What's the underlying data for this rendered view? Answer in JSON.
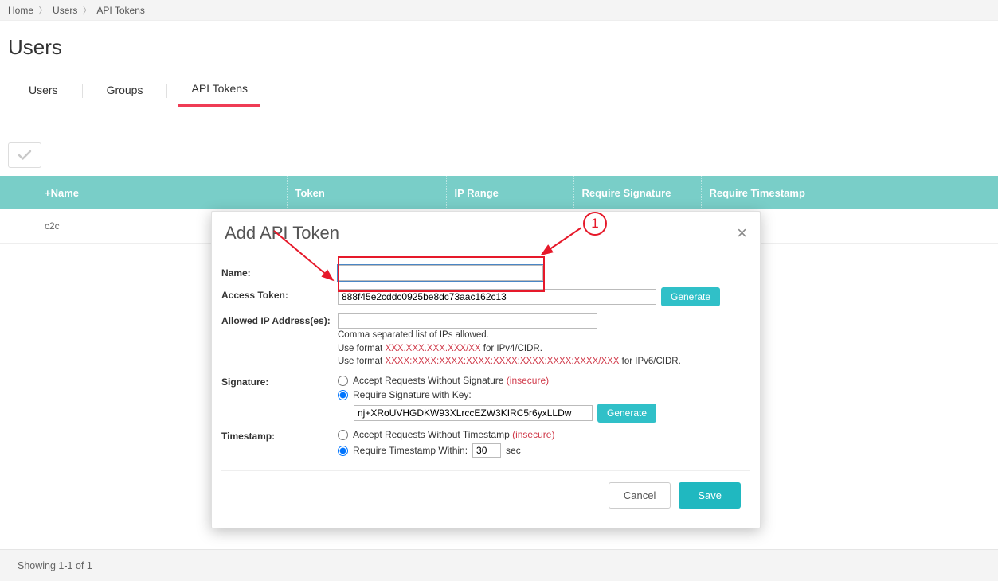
{
  "breadcrumb": {
    "home": "Home",
    "users": "Users",
    "tokens": "API Tokens"
  },
  "page_title": "Users",
  "tabs": {
    "users": "Users",
    "groups": "Groups",
    "api_tokens": "API Tokens"
  },
  "table": {
    "headers": {
      "name": "+Name",
      "token": "Token",
      "ip": "IP Range",
      "sig": "Require Signature",
      "ts": "Require Timestamp"
    },
    "rows": [
      {
        "name": "c2c"
      }
    ]
  },
  "footer": {
    "paging": "Showing 1-1 of 1"
  },
  "modal": {
    "title": "Add API Token",
    "labels": {
      "name": "Name:",
      "access_token": "Access Token:",
      "allowed_ips": "Allowed IP Address(es):",
      "signature": "Signature:",
      "timestamp": "Timestamp:"
    },
    "name_value": "",
    "token_value": "888f45e2cddc0925be8dc73aac162c13",
    "ip_value": "",
    "ip_hint_line1": "Comma separated list of IPs allowed.",
    "ip_hint_line2_a": "Use format ",
    "ip_hint_fmt4": "XXX.XXX.XXX.XXX/XX",
    "ip_hint_line2_b": " for IPv4/CIDR.",
    "ip_hint_line3_a": "Use format ",
    "ip_hint_fmt6": "XXXX:XXXX:XXXX:XXXX:XXXX:XXXX:XXXX:XXXX/XXX",
    "ip_hint_line3_b": " for IPv6/CIDR.",
    "sig_opt_no": "Accept Requests Without Signature ",
    "sig_opt_key": "Require Signature with Key:",
    "sig_key_value": "nj+XRoUVHGDKW93XLrccEZW3KIRC5r6yxLLDw",
    "ts_opt_no": "Accept Requests Without Timestamp ",
    "ts_opt_req_a": "Require Timestamp Within: ",
    "ts_value": "30",
    "ts_opt_req_b": " sec",
    "insecure": "(insecure)",
    "generate": "Generate",
    "cancel": "Cancel",
    "save": "Save"
  },
  "annotation": {
    "callout": "1"
  }
}
